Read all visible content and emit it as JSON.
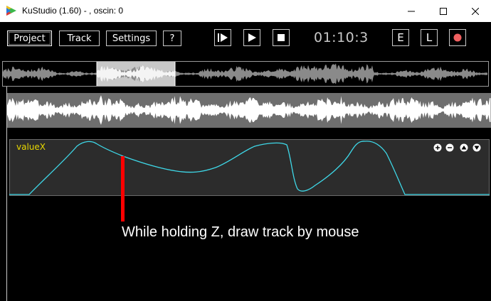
{
  "window": {
    "title": "KuStudio (1.60) - , oscin: 0"
  },
  "toolbar": {
    "project_label": "Project",
    "track_label": "Track",
    "settings_label": "Settings",
    "help_label": "?",
    "time": "01:10:3",
    "e_label": "E",
    "l_label": "L",
    "record_color": "#f06060"
  },
  "track": {
    "name": "valueX",
    "curve_color": "#3ed8e8"
  },
  "annotation": {
    "text": "While holding Z, draw track by mouse",
    "pen_color": "#ff0000"
  }
}
